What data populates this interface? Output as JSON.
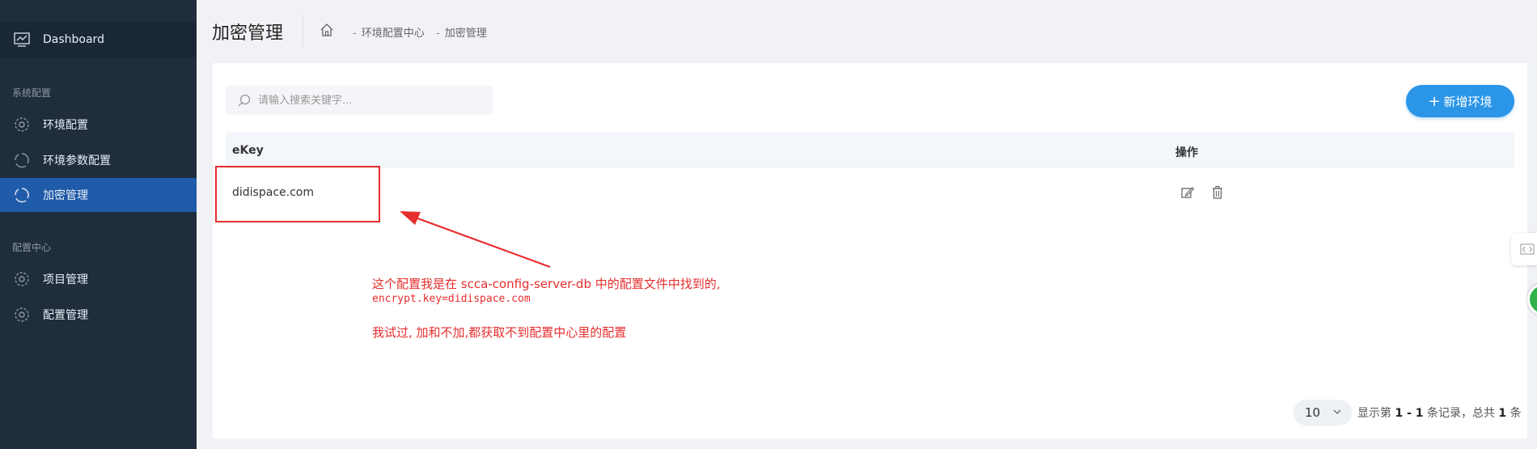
{
  "sidebar": {
    "dashboard_label": "Dashboard",
    "group_system": "系统配置",
    "items_system": [
      {
        "label": "环境配置",
        "icon": "gear-icon"
      },
      {
        "label": "环境参数配置",
        "icon": "gear-icon"
      },
      {
        "label": "加密管理",
        "icon": "gear-icon",
        "active": true
      }
    ],
    "group_config": "配置中心",
    "items_config": [
      {
        "label": "项目管理",
        "icon": "gear-icon"
      },
      {
        "label": "配置管理",
        "icon": "gear-icon"
      }
    ]
  },
  "header": {
    "title": "加密管理",
    "breadcrumb": [
      "环境配置中心",
      "加密管理"
    ],
    "breadcrumb_sep": "-"
  },
  "toolbar": {
    "search_placeholder": "请输入搜索关键字...",
    "add_label": "新增环境",
    "add_icon": "+"
  },
  "table": {
    "columns": [
      "eKey",
      "操作"
    ],
    "rows": [
      {
        "ekey": "didispace.com"
      }
    ]
  },
  "annotation": {
    "line1": "这个配置我是在 scca-config-server-db 中的配置文件中找到的,",
    "line2": "encrypt.key=didispace.com",
    "line3": "我试过, 加和不加,都获取不到配置中心里的配置"
  },
  "pagination": {
    "page_size": "10",
    "info_prefix": "显示第 ",
    "info_range": "1 - 1",
    "info_mid": " 条记录，总共 ",
    "info_total": "1",
    "info_suffix": " 条"
  },
  "colors": {
    "sidebar_bg": "#1f2d3d",
    "active_bg": "#1f5ba8",
    "accent": "#2b95e8",
    "annotation_red": "#e62e2e"
  }
}
